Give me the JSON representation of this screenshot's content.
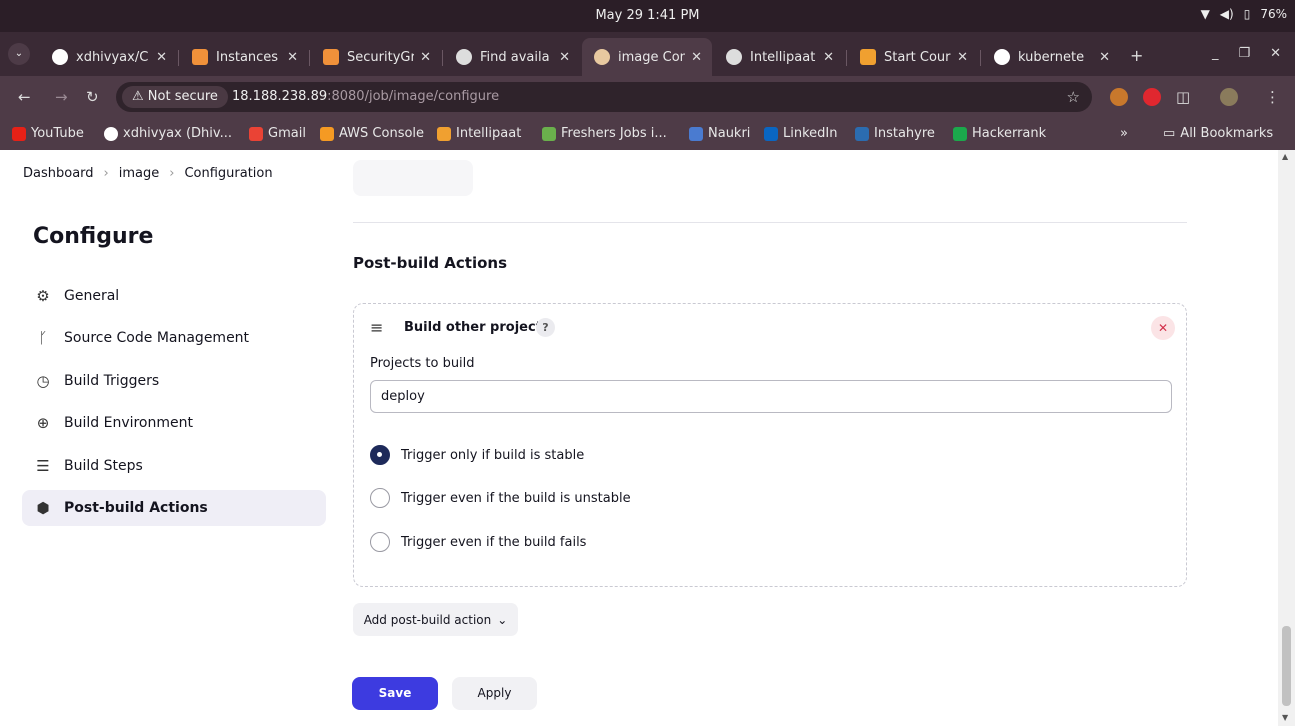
{
  "os": {
    "clock": "May 29  1:41 PM",
    "battery": "76%"
  },
  "tabs": [
    {
      "label": "xdhivyax/C",
      "favicon_color": "#ffffff"
    },
    {
      "label": "Instances |",
      "favicon_color": "#f0913a"
    },
    {
      "label": "SecurityGr",
      "favicon_color": "#f0913a"
    },
    {
      "label": "Find availa",
      "favicon_color": "#dddddd"
    },
    {
      "label": "image Con",
      "favicon_color": "#e8c9a0"
    },
    {
      "label": "Intellipaat",
      "favicon_color": "#dddddd"
    },
    {
      "label": "Start Cour",
      "favicon_color": "#f0a030"
    },
    {
      "label": "kubernete",
      "favicon_color": "#ffffff"
    }
  ],
  "address": {
    "not_secure": "⚠ Not secure",
    "host": "18.188.238.89",
    "path": ":8080/job/image/configure"
  },
  "bookmarks": [
    {
      "label": "YouTube",
      "color": "#e62117"
    },
    {
      "label": "xdhivyax (Dhiv...",
      "color": "#ffffff"
    },
    {
      "label": "Gmail",
      "color": "#ea4335"
    },
    {
      "label": "AWS Console",
      "color": "#f59a23"
    },
    {
      "label": "Intellipaat",
      "color": "#f0a030"
    },
    {
      "label": "Freshers Jobs i...",
      "color": "#6ab04c"
    },
    {
      "label": "Naukri",
      "color": "#4a7bd0"
    },
    {
      "label": "LinkedIn",
      "color": "#0a66c2"
    },
    {
      "label": "Instahyre",
      "color": "#2b6cb0"
    },
    {
      "label": "Hackerrank",
      "color": "#1ba94c"
    }
  ],
  "all_bookmarks": "All Bookmarks",
  "breadcrumb": {
    "dashboard": "Dashboard",
    "job": "image",
    "page": "Configuration"
  },
  "sidebar": {
    "title": "Configure",
    "items": [
      {
        "label": "General",
        "icon": "gear-icon"
      },
      {
        "label": "Source Code Management",
        "icon": "branch-icon"
      },
      {
        "label": "Build Triggers",
        "icon": "clock-icon"
      },
      {
        "label": "Build Environment",
        "icon": "globe-icon"
      },
      {
        "label": "Build Steps",
        "icon": "list-icon"
      },
      {
        "label": "Post-build Actions",
        "icon": "package-icon"
      }
    ]
  },
  "section": {
    "title": "Post-build Actions",
    "card": {
      "title": "Build other projects",
      "help": "?",
      "field_label": "Projects to build",
      "field_value": "deploy",
      "radios": [
        {
          "label": "Trigger only if build is stable",
          "checked": true
        },
        {
          "label": "Trigger even if the build is unstable",
          "checked": false
        },
        {
          "label": "Trigger even if the build fails",
          "checked": false
        }
      ]
    },
    "add_button": "Add post-build action"
  },
  "actions": {
    "save": "Save",
    "apply": "Apply"
  }
}
